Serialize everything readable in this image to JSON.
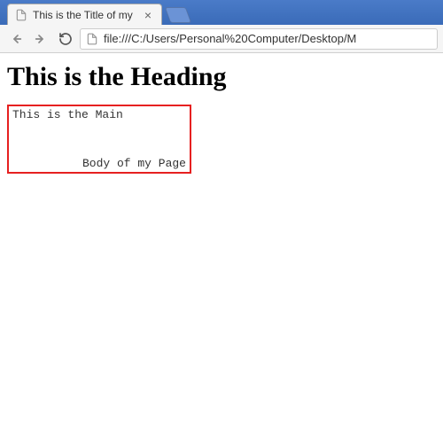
{
  "browser": {
    "tab": {
      "title": "This is the Title of my",
      "close_glyph": "×"
    },
    "toolbar": {
      "url": "file:///C:/Users/Personal%20Computer/Desktop/M"
    }
  },
  "page": {
    "heading": "This is the Heading",
    "box": {
      "line1": "This is the Main",
      "line2": "Body of my Page"
    }
  }
}
